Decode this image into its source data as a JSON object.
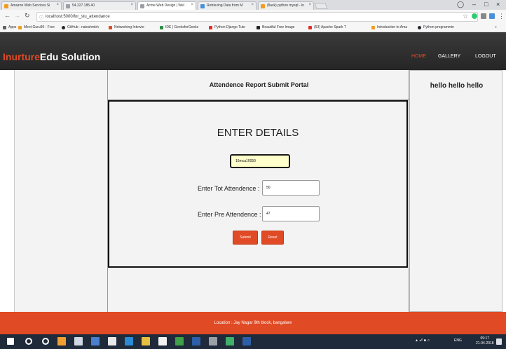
{
  "browser": {
    "tabs": [
      {
        "label": "Amazon Web Services Si",
        "color": "#f29b1f"
      },
      {
        "label": "54.227.185.40",
        "color": "#9aa0a6"
      },
      {
        "label": "Acme Web Design | Wel",
        "color": "#9aa0a6"
      },
      {
        "label": "Retrieving Data from M",
        "color": "#4a90d9"
      },
      {
        "label": "(flask) python mysql - In",
        "color": "#f29b1f"
      }
    ],
    "active_tab": 2,
    "url": "localhost:5000/for_stu_attendance",
    "bookmarks": [
      {
        "label": "Apps",
        "color": "#5f6368"
      },
      {
        "label": "Meet Guru99 - Free",
        "color": "#f29b1f"
      },
      {
        "label": "GitHub - nateshmbh",
        "color": "#24292e"
      },
      {
        "label": "Networking Intervie",
        "color": "#e04a24"
      },
      {
        "label": "IDE | GeeksforGeeks",
        "color": "#2f8d46"
      },
      {
        "label": "Python Django Tuto",
        "color": "#e52d27"
      },
      {
        "label": "Beautiful Free Image",
        "color": "#222222"
      },
      {
        "label": "(53) Apache Spark T",
        "color": "#e52d27"
      },
      {
        "label": "Introduction to Ama",
        "color": "#f29b1f"
      },
      {
        "label": "Python-programmin",
        "color": "#24292e"
      }
    ]
  },
  "site": {
    "logo_brand": "Inurture",
    "logo_rest": "Edu Solution",
    "nav": [
      "HOME",
      "GALLERY",
      "LOGOUT"
    ],
    "accent": "#e04a24"
  },
  "main": {
    "portal_title": "Attendence Report Submit Portal",
    "sidebar_right": "hello hello hello",
    "heading": "ENTER DETAILS",
    "roll_value": "16mca10050",
    "tot_label": "Enter Tot Attendence :",
    "tot_value": "50",
    "pre_label": "Enter Pre Attendence :",
    "pre_value": "47",
    "submit_label": "Submit",
    "reset_label": "Reset"
  },
  "footer": {
    "location": "Location : Jay Nagar 9th block, bangalore"
  },
  "taskbar": {
    "tray_text": "ENG",
    "time": "09:17",
    "date": "21-04-2018"
  }
}
